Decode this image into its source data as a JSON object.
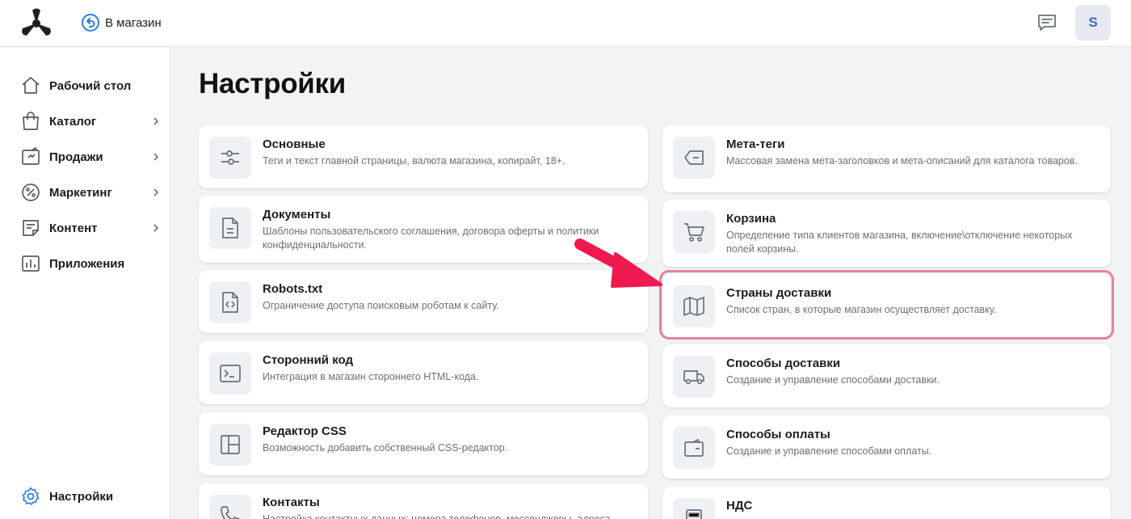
{
  "header": {
    "back_label": "В магазин",
    "avatar_initial": "S",
    "accent_color": "#2d7be0"
  },
  "sidebar": {
    "items": [
      {
        "label": "Рабочий стол",
        "icon": "home-icon",
        "has_submenu": false
      },
      {
        "label": "Каталог",
        "icon": "shopping-bag-icon",
        "has_submenu": true
      },
      {
        "label": "Продажи",
        "icon": "sales-icon",
        "has_submenu": true
      },
      {
        "label": "Маркетинг",
        "icon": "percent-icon",
        "has_submenu": true
      },
      {
        "label": "Контент",
        "icon": "document-icon",
        "has_submenu": true
      },
      {
        "label": "Приложения",
        "icon": "bar-chart-icon",
        "has_submenu": false
      }
    ],
    "bottom_item": {
      "label": "Настройки",
      "icon": "gear-icon"
    }
  },
  "page": {
    "title": "Настройки"
  },
  "cards_left": [
    {
      "title": "Основные",
      "desc": "Теги и текст главной страницы, валюта магазина, копирайт, 18+.",
      "icon": "sliders-icon"
    },
    {
      "title": "Документы",
      "desc": "Шаблоны пользовательского соглашения, договора оферты и политики конфиденциальности.",
      "icon": "file-text-icon"
    },
    {
      "title": "Robots.txt",
      "desc": "Ограничение доступа поисковым роботам к сайту.",
      "icon": "file-code-icon"
    },
    {
      "title": "Сторонний код",
      "desc": "Интеграция в магазин стороннего HTML-кода.",
      "icon": "terminal-icon"
    },
    {
      "title": "Редактор CSS",
      "desc": "Возможность добавить собственный CSS-редактор.",
      "icon": "layout-icon"
    },
    {
      "title": "Контакты",
      "desc": "Настройка контактных данных: номера телефонов, мессенджеры, адреса",
      "icon": "phone-icon"
    }
  ],
  "cards_right": [
    {
      "title": "Мета-теги",
      "desc": "Массовая замена мета-заголовков и мета-описаний для каталога товаров.",
      "icon": "tag-icon"
    },
    {
      "title": "Корзина",
      "desc": "Определение типа клиентов магазина, включение\\отключение некоторых полей корзины.",
      "icon": "cart-icon"
    },
    {
      "title": "Страны доставки",
      "desc": "Список стран, в которые магазин осуществляет доставку.",
      "icon": "map-icon",
      "highlighted": true
    },
    {
      "title": "Способы доставки",
      "desc": "Создание и управление способами доставки.",
      "icon": "truck-icon"
    },
    {
      "title": "Способы оплаты",
      "desc": "Создание и управление способами оплаты.",
      "icon": "wallet-icon"
    },
    {
      "title": "НДС",
      "desc": "",
      "icon": "calculator-icon"
    }
  ],
  "annotation": {
    "highlight_color": "#e8829c",
    "arrow_color": "#f0194f"
  }
}
